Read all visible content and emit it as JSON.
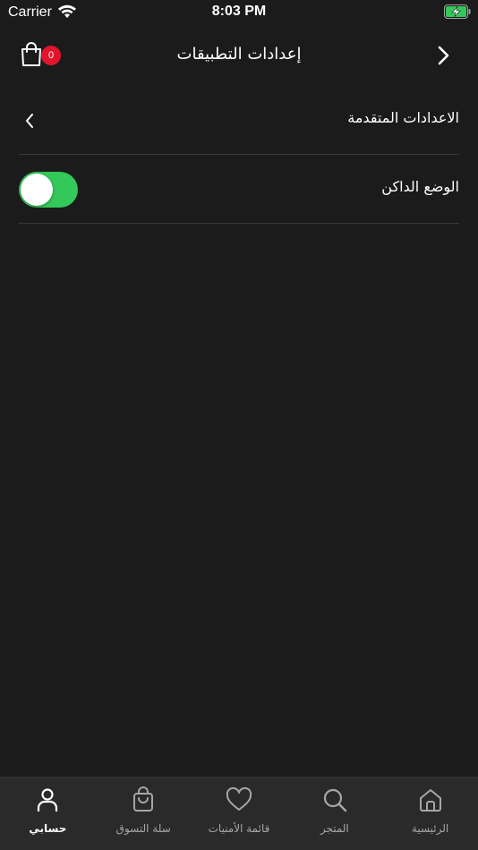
{
  "status_bar": {
    "carrier": "Carrier",
    "time": "8:03 PM"
  },
  "header": {
    "title": "إعدادات التطبيقات",
    "cart_count": "0",
    "icons": [
      "cart-icon",
      "chevron-right-icon"
    ]
  },
  "settings": {
    "advanced_label": "الاعدادات المتقدمة",
    "dark_mode_label": "الوضع الداكن",
    "dark_mode_on": true
  },
  "tab_bar": {
    "tabs": [
      {
        "label": "حسابي",
        "icon": "user-icon",
        "active": true
      },
      {
        "label": "سلة التسوق",
        "icon": "shopping-bag-icon",
        "active": false
      },
      {
        "label": "قائمة الأمنيات",
        "icon": "heart-icon",
        "active": false
      },
      {
        "label": "المتجر",
        "icon": "search-icon",
        "active": false
      },
      {
        "label": "الرئيسية",
        "icon": "home-icon",
        "active": false
      }
    ]
  },
  "colors": {
    "background": "#1b1b1b",
    "tab_bar": "#2a2a2a",
    "toggle_on": "#34c759",
    "badge": "#e2142d",
    "battery_green": "#34c759"
  }
}
